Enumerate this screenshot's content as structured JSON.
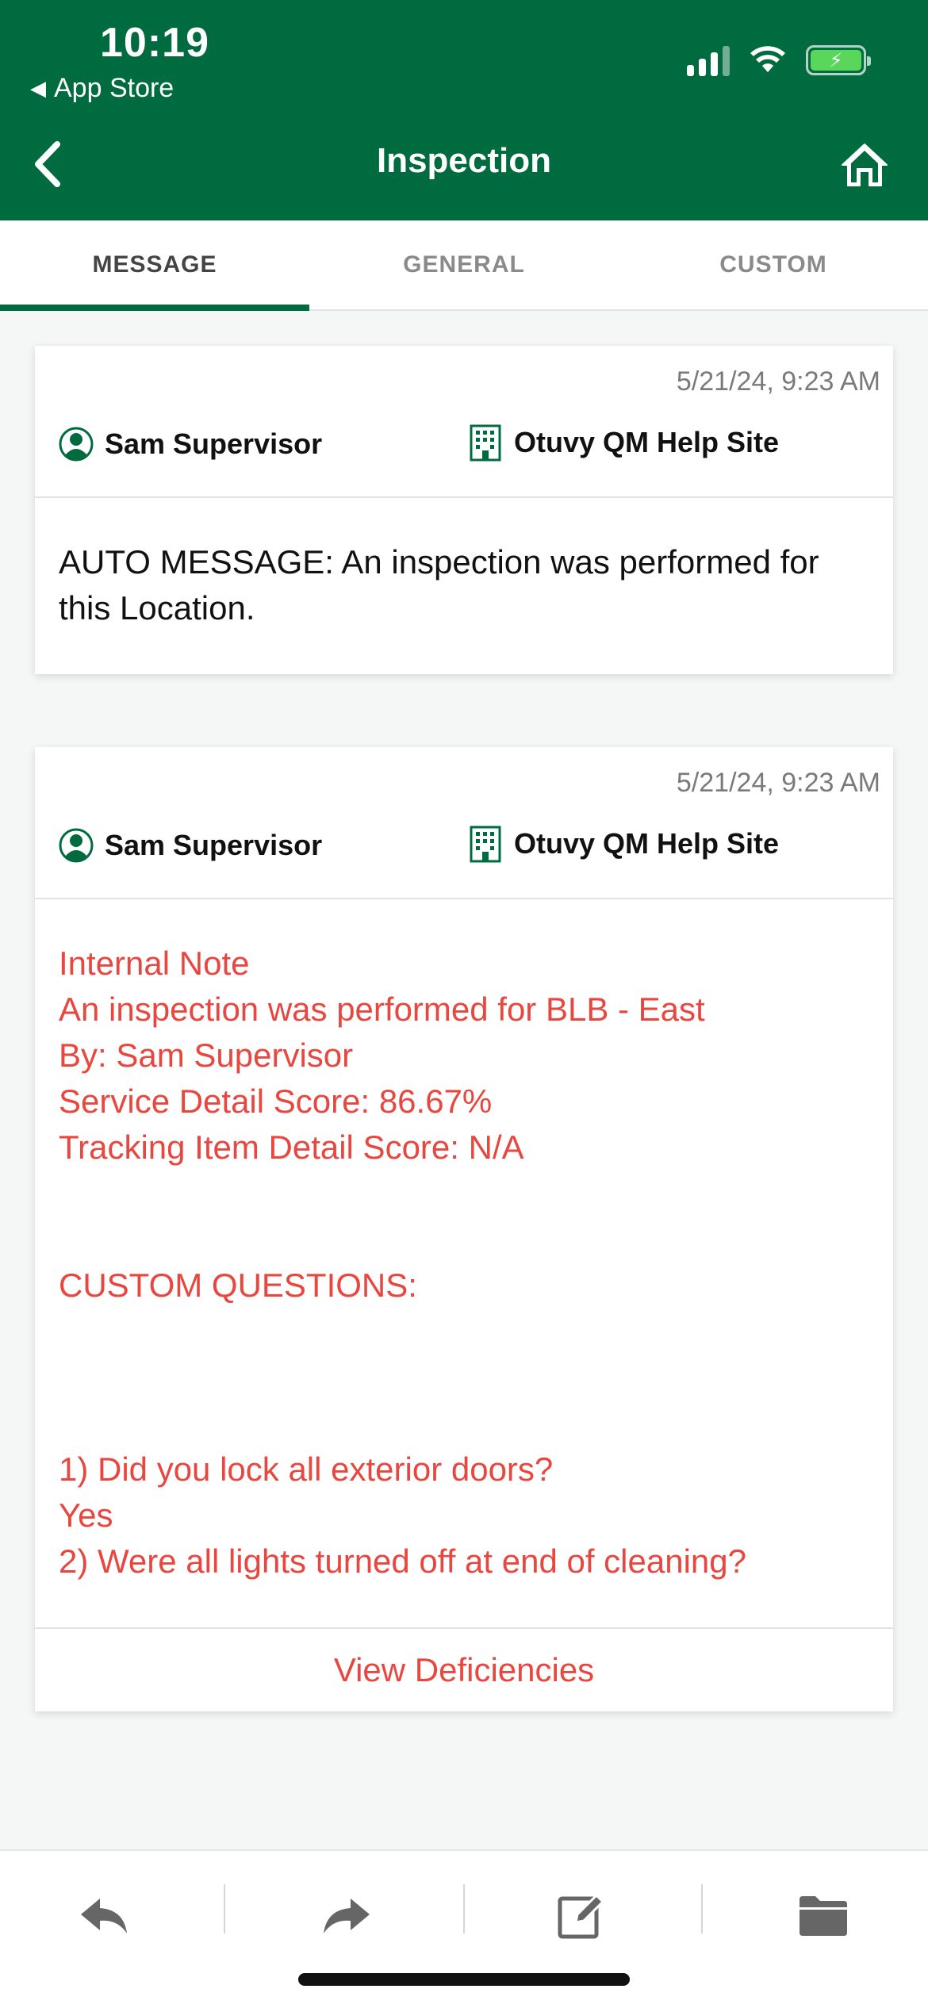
{
  "status_bar": {
    "time": "10:19",
    "back_app": "App Store"
  },
  "nav": {
    "title": "Inspection",
    "back_icon": "chevron-left-icon",
    "home_icon": "home-icon"
  },
  "tabs": [
    {
      "label": "MESSAGE",
      "active": true
    },
    {
      "label": "GENERAL",
      "active": false
    },
    {
      "label": "CUSTOM",
      "active": false
    }
  ],
  "messages": [
    {
      "date": "5/21/24, 9:23 AM",
      "person": "Sam Supervisor",
      "site": "Otuvy QM Help Site",
      "body": "AUTO MESSAGE: An inspection was performed for this Location."
    },
    {
      "date": "5/21/24, 9:23 AM",
      "person": "Sam Supervisor",
      "site": "Otuvy QM Help Site",
      "note_lines": [
        "Internal Note",
        "An inspection was performed for BLB - East",
        "By: Sam Supervisor",
        "Service Detail Score: 86.67%",
        "Tracking Item Detail Score: N/A",
        "",
        "",
        "CUSTOM QUESTIONS:",
        "",
        "",
        "",
        "1) Did you lock all exterior doors?",
        "Yes",
        "2) Were all lights turned off at end of cleaning?"
      ],
      "footer_link": "View Deficiencies"
    }
  ],
  "toolbar": {
    "icons": [
      "reply-icon",
      "forward-icon",
      "edit-icon",
      "folder-icon"
    ]
  },
  "colors": {
    "brand_green": "#006b3f",
    "note_red": "#e8473f"
  }
}
